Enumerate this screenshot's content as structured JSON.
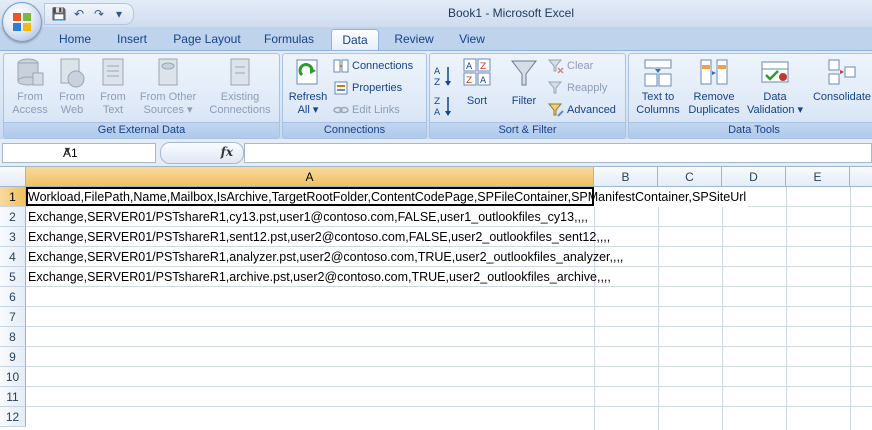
{
  "window": {
    "title": "Book1 - Microsoft Excel"
  },
  "qat": {
    "save": "💾",
    "undo": "↶",
    "redo": "↷",
    "more": "▾"
  },
  "tabs": [
    "Home",
    "Insert",
    "Page Layout",
    "Formulas",
    "Data",
    "Review",
    "View"
  ],
  "active_tab": "Data",
  "ribbon": {
    "external": {
      "label": "Get External Data",
      "from_access": [
        "From",
        "Access"
      ],
      "from_web": [
        "From",
        "Web"
      ],
      "from_text": [
        "From",
        "Text"
      ],
      "from_other": [
        "From Other",
        "Sources ▾"
      ],
      "existing": [
        "Existing",
        "Connections"
      ]
    },
    "connections": {
      "label": "Connections",
      "refresh": [
        "Refresh",
        "All ▾"
      ],
      "connections": "Connections",
      "properties": "Properties",
      "edit_links": "Edit Links"
    },
    "sort": {
      "label": "Sort & Filter",
      "sort": "Sort",
      "filter": "Filter",
      "clear": "Clear",
      "reapply": "Reapply",
      "advanced": "Advanced"
    },
    "tools": {
      "label": "Data Tools",
      "text_to_columns": [
        "Text to",
        "Columns"
      ],
      "remove_duplicates": [
        "Remove",
        "Duplicates"
      ],
      "data_validation": [
        "Data",
        "Validation ▾"
      ],
      "consolidate": "Consolidate"
    }
  },
  "formula_bar": {
    "name_box": "A1",
    "fx": "fx",
    "value": ""
  },
  "columns": [
    "A",
    "B",
    "C",
    "D",
    "E"
  ],
  "rows": [
    "1",
    "2",
    "3",
    "4",
    "5",
    "6",
    "7",
    "8",
    "9",
    "10",
    "11",
    "12"
  ],
  "cells": [
    "Workload,FilePath,Name,Mailbox,IsArchive,TargetRootFolder,ContentCodePage,SPFileContainer,SPManifestContainer,SPSiteUrl",
    "Exchange,SERVER01/PSTshareR1,cy13.pst,user1@contoso.com,FALSE,user1_outlookfiles_cy13,,,,",
    "Exchange,SERVER01/PSTshareR1,sent12.pst,user2@contoso.com,FALSE,user2_outlookfiles_sent12,,,,",
    "Exchange,SERVER01/PSTshareR1,analyzer.pst,user2@contoso.com,TRUE,user2_outlookfiles_analyzer,,,,",
    "Exchange,SERVER01/PSTshareR1,archive.pst,user2@contoso.com,TRUE,user2_outlookfiles_archive,,,,"
  ]
}
